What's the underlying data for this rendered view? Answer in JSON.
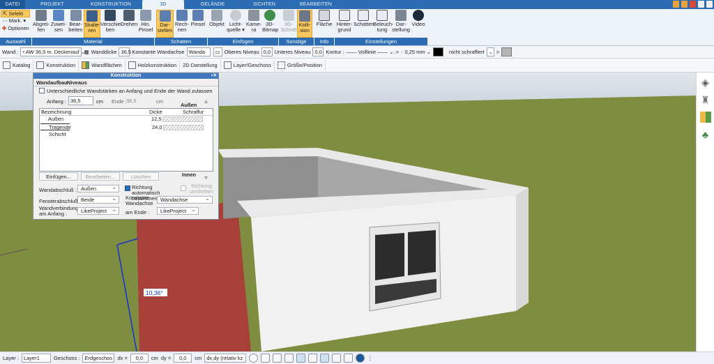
{
  "tabs": [
    {
      "label": "DATEI"
    },
    {
      "label": "PROJEKT"
    },
    {
      "label": "KONSTRUKTION"
    },
    {
      "label": "3D"
    },
    {
      "label": "GELÄNDE"
    },
    {
      "label": "SICHTEN"
    },
    {
      "label": "BEARBEITEN"
    }
  ],
  "select_group": {
    "selekt": "Selekt",
    "mark": "Mark.",
    "optionen": "Optionen"
  },
  "ribbon": {
    "buttons": [
      {
        "l1": "Abgrei-",
        "l2": "fen"
      },
      {
        "l1": "Zuwei-",
        "l2": "sen"
      },
      {
        "l1": "Bear-",
        "l2": "beiten"
      },
      {
        "l1": "Skalie-",
        "l2": "ren"
      },
      {
        "l1": "Verschie-",
        "l2": "ben"
      },
      {
        "l1": "Drehen",
        "l2": ""
      },
      {
        "l1": "Hin.",
        "l2": "Pinsel"
      },
      {
        "l1": "Dar-",
        "l2": "stellen"
      },
      {
        "l1": "Rech-",
        "l2": "nen"
      },
      {
        "l1": "Pinsel",
        "l2": ""
      },
      {
        "l1": "Objekt",
        "l2": ""
      },
      {
        "l1": "Licht-",
        "l2": "quelle ▾"
      },
      {
        "l1": "Kame-",
        "l2": "ra"
      },
      {
        "l1": "3D-",
        "l2": "Bitmap"
      },
      {
        "l1": "3D-",
        "l2": "Schnitt"
      },
      {
        "l1": "Kolli-",
        "l2": "sion"
      },
      {
        "l1": "Fläche",
        "l2": ""
      },
      {
        "l1": "Hinter-",
        "l2": "grund"
      },
      {
        "l1": "Schatten",
        "l2": ""
      },
      {
        "l1": "Beleuch-",
        "l2": "tung"
      },
      {
        "l1": "Dar-",
        "l2": "stellung"
      },
      {
        "l1": "Video",
        "l2": ""
      }
    ],
    "groups": [
      "Auswahl",
      "Material",
      "Schatten",
      "Einfügen",
      "Sonstige",
      "Info",
      "Einstellungen"
    ]
  },
  "props": {
    "wand_label": "Wand :",
    "wand_value": "AW 36,5 m. Deckenauf",
    "wanddicke_label": "Wanddicke",
    "wanddicke": "36,5",
    "konstante_label": "Konstante Wandachse",
    "konstante_value": "Wanda",
    "oberes_label": "Oberes Niveau",
    "oberes_value": "0,0",
    "unteres_label": "Unteres Niveau",
    "unteres_value": "0,0",
    "kontur_label": "Kontur :",
    "linie": "Volllinie",
    "mm": "0,25 mm",
    "schraffur": "nicht schraffiert",
    "gt": ">",
    "dot": "·"
  },
  "toolbar2": [
    "Katalog",
    "Konstruktion",
    "Wandflächen",
    "Holzkonstruktion",
    "2D Darstellung",
    "Layer/Geschoss",
    "Größe/Position"
  ],
  "dialog": {
    "title": "Konstruktion",
    "tab1": "Wandaufbau",
    "tab2": "Niveaus",
    "checkbox_label": "Unterschiedliche Wandstärken an Anfang und Ende der Wand zulassen",
    "anfang_label": "Anfang :",
    "anfang": "36,5",
    "cm": "cm",
    "ende_label": "Ende :",
    "ende": "36,5",
    "aussen": "Außen",
    "innen": "Innen",
    "columns": [
      "Bezeichnung",
      "Dicke",
      "Schraffur"
    ],
    "rows": [
      {
        "name": "Außen",
        "dicke": "12,5"
      },
      {
        "name": "Tragende Schicht",
        "dicke": "24,0"
      }
    ],
    "btn_einfuegen": "Einfügen...",
    "btn_bearbeiten": "Bearbeiten...",
    "btn_loeschen": "Löschen",
    "wandabschluss_label": "Wandabschluß :",
    "wandabschluss": "Außen",
    "richtung_auto": "Richtung automatisch bestimmen",
    "richtung_umdrehen": "Richtung umdrehen",
    "fensterabschluss_label": "Fensterabschluß :",
    "fensterabschluss": "Beide",
    "konstante_label": "Konstante Wandachse",
    "konstante": "Wandachse",
    "wandverbindung_label": "Wandverbindung am Anfang :",
    "wandverbindung": "LikeProject",
    "am_ende_label": "am Ende :",
    "am_ende": "LikeProject"
  },
  "scene": {
    "dimension": "10,36°"
  },
  "status": {
    "layer_label": "Layer :",
    "layer": "Layer1",
    "geschoss_label": "Geschoss :",
    "geschoss": "Erdgeschos",
    "dx_label": "dx =",
    "dx": "0,0",
    "dy_label": "dy =",
    "dy": "0,0",
    "cm": "cm",
    "mode": "dx,dy (relativ kz"
  },
  "colors": {
    "accent": "#2b6cb3",
    "wall_red": "#a8403a",
    "grass": "#7d8b3e",
    "sky": "#d4dde6"
  }
}
